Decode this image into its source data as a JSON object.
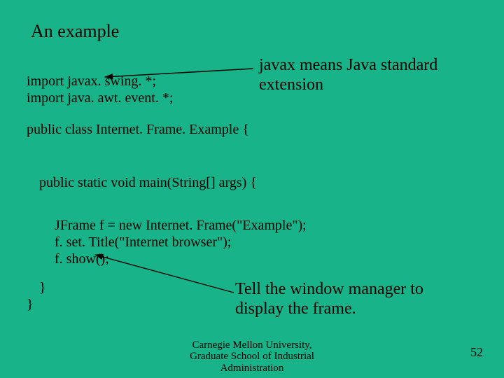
{
  "title": "An example",
  "code": {
    "import1": "import javax. swing. *;",
    "import2": "import java. awt. event. *;",
    "classdecl": "public class Internet. Frame. Example {",
    "mainsig": "public static void main(String[] args) {",
    "line1": "JFrame f = new Internet. Frame(\"Example\");",
    "line2": "f. set. Title(\"Internet browser\");",
    "line3": "f. show();",
    "close_inner": "}",
    "close_outer": "}"
  },
  "annotations": {
    "javax_l1": "javax means Java standard",
    "javax_l2": "extension",
    "show_l1": "Tell the window manager to",
    "show_l2": "display the frame."
  },
  "footer": {
    "line1": "Carnegie Mellon University,",
    "line2": "Graduate School of Industrial",
    "line3": "Administration"
  },
  "page": "52"
}
